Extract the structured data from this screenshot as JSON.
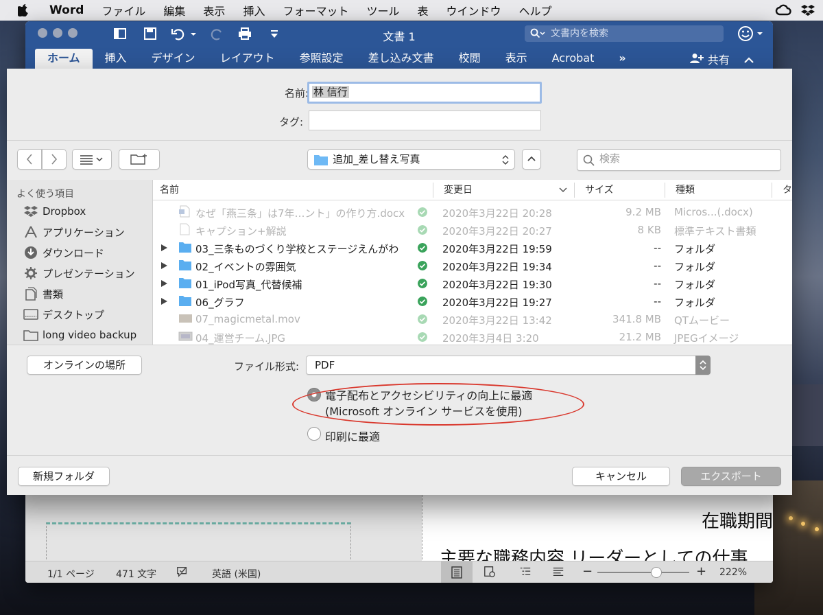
{
  "menubar": {
    "app": "Word",
    "items": [
      "ファイル",
      "編集",
      "表示",
      "挿入",
      "フォーマット",
      "ツール",
      "表",
      "ウインドウ",
      "ヘルプ"
    ]
  },
  "word": {
    "title": "文書 1",
    "search_placeholder": "文書内を検索",
    "tabs": [
      "ホーム",
      "挿入",
      "デザイン",
      "レイアウト",
      "参照設定",
      "差し込み文書",
      "校閲",
      "表示",
      "Acrobat"
    ],
    "more": "»",
    "share": "共有",
    "doc_text_1": "在職期間",
    "doc_text_2": "主要な職務内容 リーダーとしての仕事",
    "status": {
      "page": "1/1 ページ",
      "words": "471 文字",
      "language": "英語 (米国)",
      "zoom": "222%",
      "zoom_level_percent": 222
    }
  },
  "dialog": {
    "name_label": "名前:",
    "name_value": "林 信行",
    "tags_label": "タグ:",
    "tags_value": "",
    "location": "追加_差し替え写真",
    "search_placeholder": "検索",
    "sidebar": {
      "header": "よく使う項目",
      "items": [
        {
          "label": "Dropbox",
          "icon": "dropbox-icon"
        },
        {
          "label": "アプリケーション",
          "icon": "applications-icon"
        },
        {
          "label": "ダウンロード",
          "icon": "download-icon"
        },
        {
          "label": "プレゼンテーション",
          "icon": "gear-folder-icon"
        },
        {
          "label": "書類",
          "icon": "documents-icon"
        },
        {
          "label": "デスクトップ",
          "icon": "desktop-icon"
        },
        {
          "label": "long video backup",
          "icon": "folder-icon"
        }
      ]
    },
    "columns": {
      "name": "名前",
      "modified": "変更日",
      "size": "サイズ",
      "kind": "種類",
      "more": "タ"
    },
    "files": [
      {
        "name": "なぜ「燕三条」は7年…ント」の作り方.docx",
        "date": "2020年3月22日 20:28",
        "size": "9.2 MB",
        "kind": "Micros...(.docx)",
        "type": "docx",
        "enabled": false,
        "folder": false
      },
      {
        "name": "キャプション+解説",
        "date": "2020年3月22日 20:27",
        "size": "8 KB",
        "kind": "標準テキスト書類",
        "type": "txt",
        "enabled": false,
        "folder": false
      },
      {
        "name": "03_三条ものづくり学校とステージえんがわ",
        "date": "2020年3月22日 19:59",
        "size": "--",
        "kind": "フォルダ",
        "type": "folder",
        "enabled": true,
        "folder": true
      },
      {
        "name": "02_イベントの雰囲気",
        "date": "2020年3月22日 19:34",
        "size": "--",
        "kind": "フォルダ",
        "type": "folder",
        "enabled": true,
        "folder": true
      },
      {
        "name": "01_iPod写真_代替候補",
        "date": "2020年3月22日 19:30",
        "size": "--",
        "kind": "フォルダ",
        "type": "folder",
        "enabled": true,
        "folder": true
      },
      {
        "name": "06_グラフ",
        "date": "2020年3月22日 19:27",
        "size": "--",
        "kind": "フォルダ",
        "type": "folder",
        "enabled": true,
        "folder": true
      },
      {
        "name": "07_magicmetal.mov",
        "date": "2020年3月22日 13:42",
        "size": "341.8 MB",
        "kind": "QTムービー",
        "type": "mov",
        "enabled": false,
        "folder": false
      },
      {
        "name": "04_運営チーム.JPG",
        "date": "2020年3月4日 3:20",
        "size": "21.2 MB",
        "kind": "JPEGイメージ",
        "type": "jpg",
        "enabled": false,
        "folder": false
      }
    ],
    "online_button": "オンラインの場所",
    "format_label": "ファイル形式:",
    "format_value": "PDF",
    "option1_line1": "電子配布とアクセシビリティの向上に最適",
    "option1_line2": "(Microsoft オンライン サービスを使用)",
    "option2": "印刷に最適",
    "selected_option": 1,
    "new_folder": "新規フォルダ",
    "cancel": "キャンセル",
    "export": "エクスポート"
  },
  "colors": {
    "word_blue": "#2c5697",
    "check_green": "#3aa35b",
    "folder_blue": "#5aaef0",
    "annotation_red": "#d9382d"
  }
}
